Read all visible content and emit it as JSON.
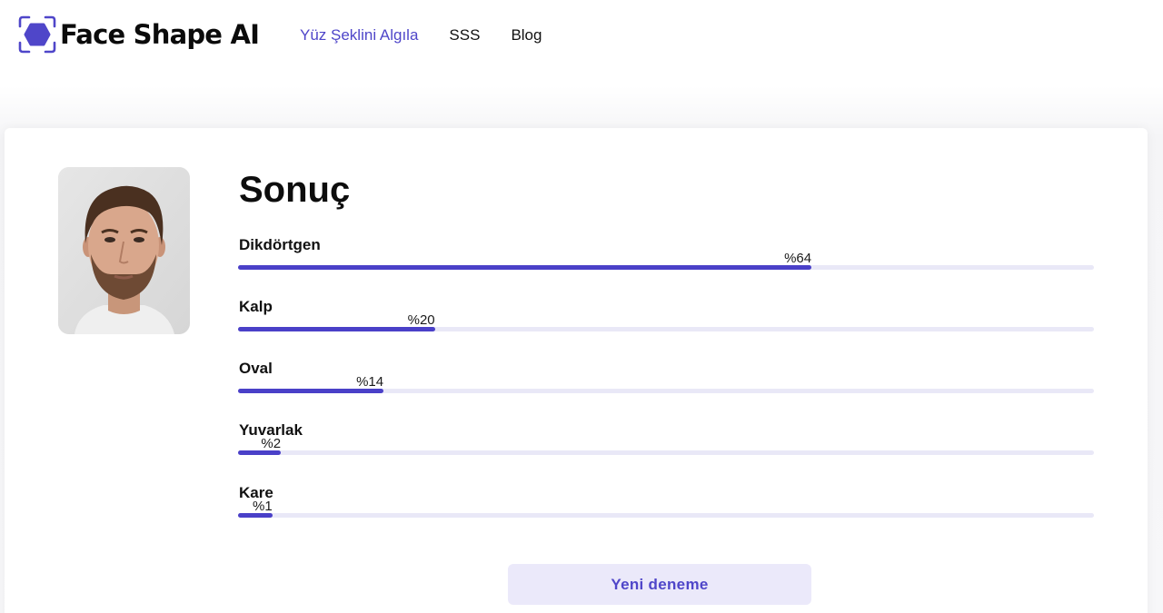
{
  "header": {
    "brand_name": "Face Shape AI",
    "logo_icon": "face-scan-icon",
    "nav": [
      {
        "label": "Yüz Şeklini Algıla",
        "active": true
      },
      {
        "label": "SSS",
        "active": false
      },
      {
        "label": "Blog",
        "active": false
      }
    ]
  },
  "result": {
    "title": "Sonuç",
    "photo_icon": "user-photo",
    "items": [
      {
        "label": "Dikdörtgen",
        "percent_text": "%64",
        "value": 0.67
      },
      {
        "label": "Kalp",
        "percent_text": "%20",
        "value": 0.23
      },
      {
        "label": "Oval",
        "percent_text": "%14",
        "value": 0.17
      },
      {
        "label": "Yuvarlak",
        "percent_text": "%2",
        "value": 0.05
      },
      {
        "label": "Kare",
        "percent_text": "%1",
        "value": 0.04
      }
    ],
    "retry_button": "Yeni deneme"
  },
  "colors": {
    "accent": "#4a40c8",
    "nav_active": "#4f46c9",
    "track": "#e9e8f7",
    "button_bg": "#ebe9fa"
  }
}
